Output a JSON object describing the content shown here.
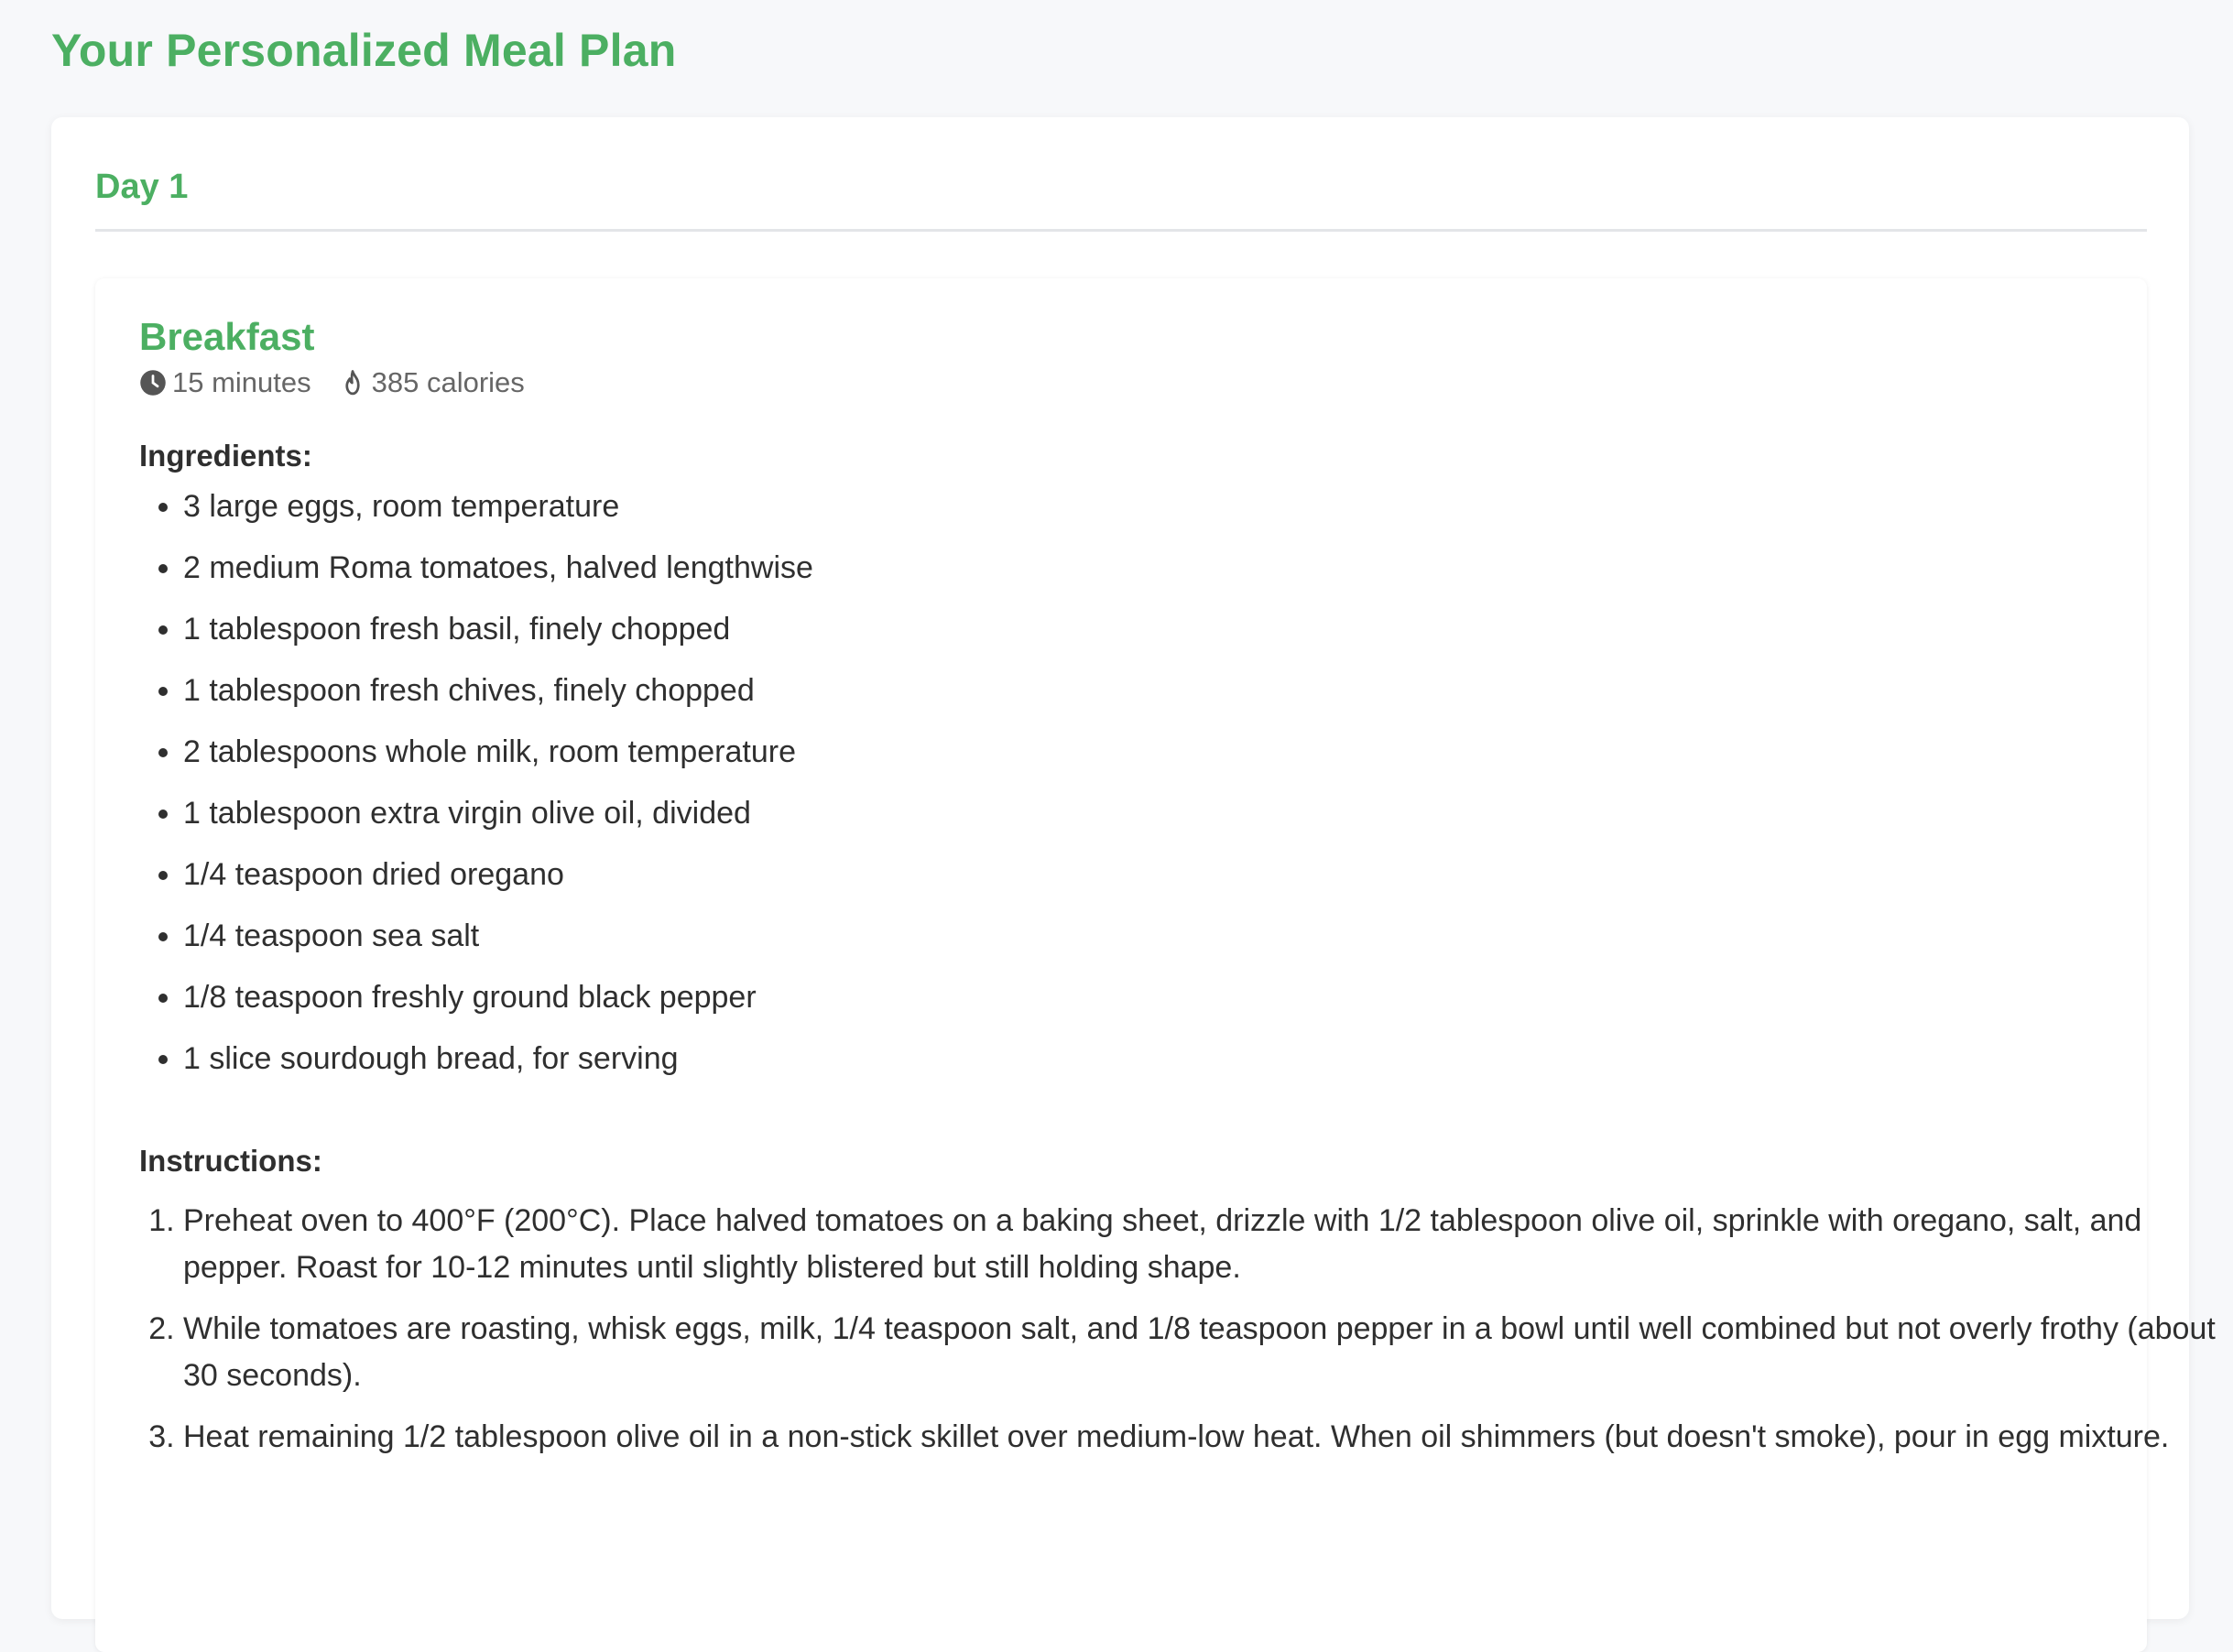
{
  "page": {
    "title": "Your Personalized Meal Plan"
  },
  "day": {
    "title": "Day 1"
  },
  "meal": {
    "title": "Breakfast",
    "time": "15 minutes",
    "time_icon": "clock-icon",
    "calories": "385 calories",
    "calories_icon": "fire-icon",
    "ingredients_label": "Ingredients:",
    "ingredients": [
      "3 large eggs, room temperature",
      "2 medium Roma tomatoes, halved lengthwise",
      "1 tablespoon fresh basil, finely chopped",
      "1 tablespoon fresh chives, finely chopped",
      "2 tablespoons whole milk, room temperature",
      "1 tablespoon extra virgin olive oil, divided",
      "1/4 teaspoon dried oregano",
      "1/4 teaspoon sea salt",
      "1/8 teaspoon freshly ground black pepper",
      "1 slice sourdough bread, for serving"
    ],
    "instructions_label": "Instructions:",
    "instructions": [
      "Preheat oven to 400°F (200°C). Place halved tomatoes on a baking sheet, drizzle with 1/2 tablespoon olive oil, sprinkle with oregano, salt, and pepper. Roast for 10-12 minutes until slightly blistered but still holding shape.",
      "While tomatoes are roasting, whisk eggs, milk, 1/4 teaspoon salt, and 1/8 teaspoon pepper in a bowl until well combined but not overly frothy (about 30 seconds).",
      "Heat remaining 1/2 tablespoon olive oil in a non-stick skillet over medium-low heat. When oil shimmers (but doesn't smoke), pour in egg mixture."
    ]
  },
  "colors": {
    "accent": "#4caf62",
    "background": "#f7f8fa",
    "text": "#2f2f2f",
    "muted": "#666666"
  }
}
